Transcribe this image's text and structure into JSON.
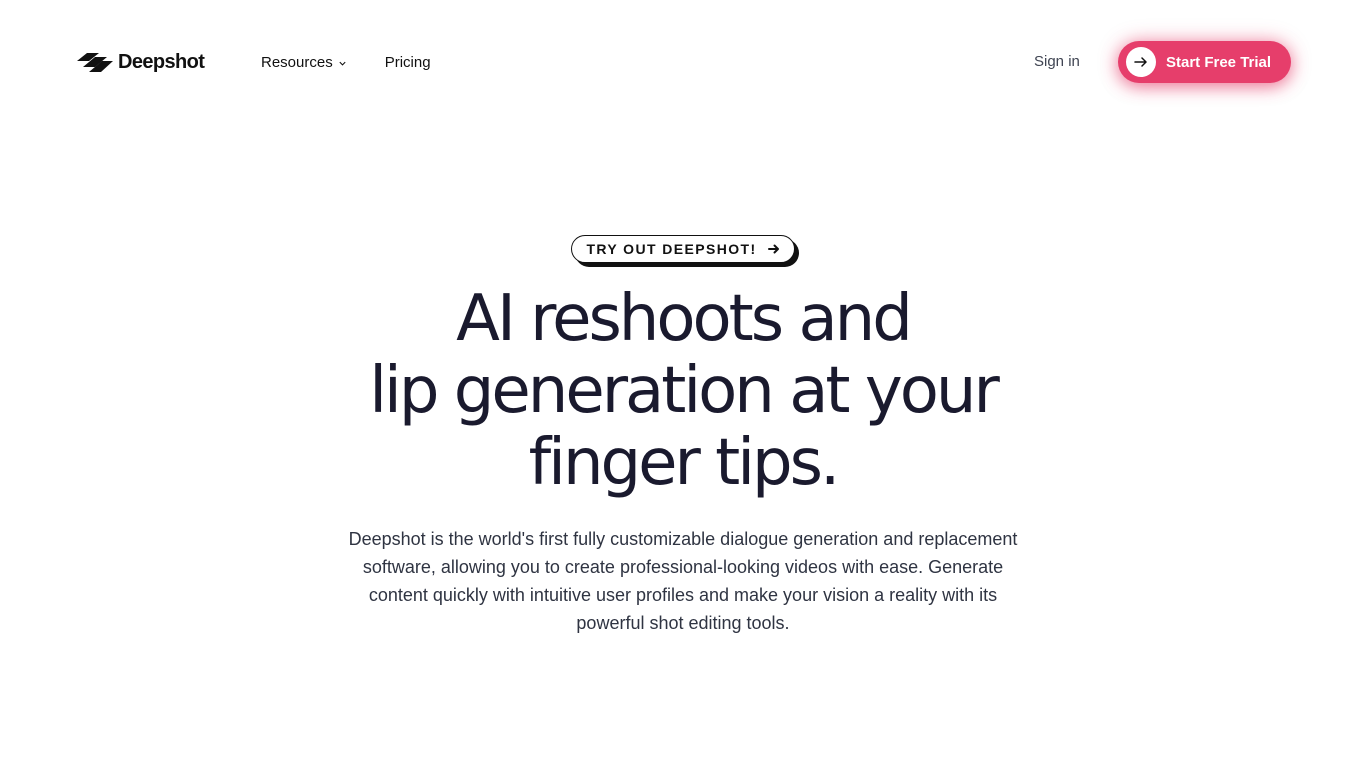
{
  "header": {
    "logo_text": "Deepshot",
    "nav": [
      {
        "label": "Resources",
        "has_dropdown": true
      },
      {
        "label": "Pricing",
        "has_dropdown": false
      }
    ],
    "sign_in_label": "Sign in",
    "cta_label": "Start Free Trial"
  },
  "hero": {
    "tag_label": "TRY OUT DEEPSHOT!",
    "headline_lines": [
      "AI reshoots and",
      "lip generation at your",
      "finger tips."
    ],
    "description": "Deepshot is the world's first fully customizable dialogue generation and replacement software, allowing you to create professional-looking videos with ease. Generate content quickly with intuitive user profiles and make your vision a reality with its powerful shot editing tools."
  },
  "icons": {
    "logo": "deepshot-logo-icon",
    "resources_dropdown": "chevron-down-icon",
    "cta": "arrow-right-icon",
    "tag": "arrow-right-icon"
  },
  "colors": {
    "accent": "#e63e6b",
    "text_dark": "#111111",
    "headline": "#1a1a2e",
    "body_text": "#2f3442",
    "background": "#ffffff"
  }
}
